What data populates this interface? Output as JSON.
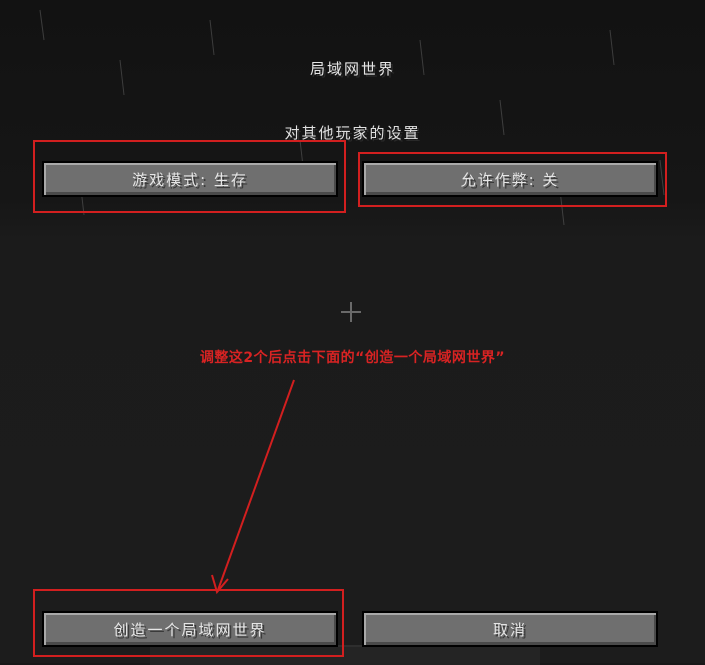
{
  "screen": {
    "title": "局域网世界",
    "subtitle": "对其他玩家的设置"
  },
  "buttons": {
    "game_mode": "游戏模式: 生存",
    "allow_cheats": "允许作弊: 关",
    "create": "创造一个局域网世界",
    "cancel": "取消"
  },
  "annotation": {
    "text": "调整这2个后点击下面的“创造一个局域网世界”",
    "color": "#d82323"
  }
}
